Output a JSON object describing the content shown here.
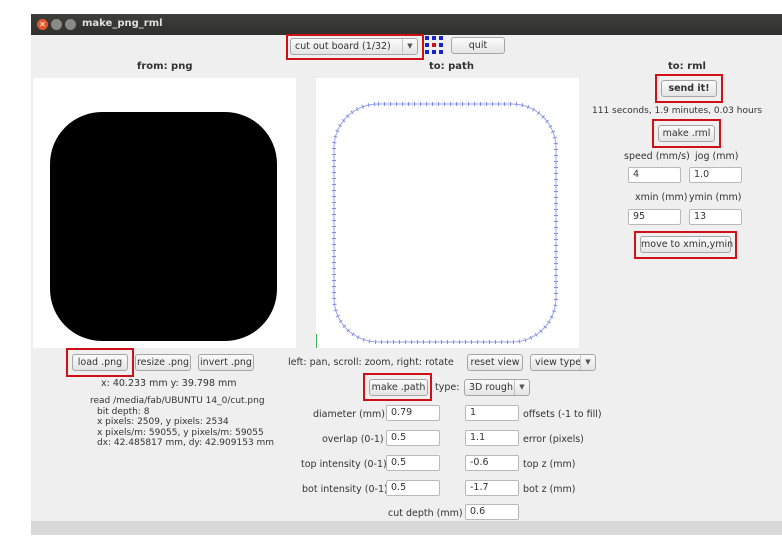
{
  "window": {
    "title": "make_png_rml"
  },
  "toolbar": {
    "mode": "cut out board (1/32)",
    "quit": "quit"
  },
  "left": {
    "header": "from: png",
    "load": "load .png",
    "resize": "resize .png",
    "invert": "invert .png",
    "coords": "x: 40.233 mm  y: 39.798 mm",
    "info": [
      "read /media/fab/UBUNTU 14_0/cut.png",
      "  bit depth: 8",
      "  x pixels: 2509, y pixels: 2534",
      "  x pixels/m: 59055, y pixels/m: 59055",
      "  dx: 42.485817 mm, dy: 42.909153 mm"
    ]
  },
  "middle": {
    "header": "to: path",
    "hint": "left: pan, scroll: zoom, right: rotate",
    "reset_view": "reset view",
    "view_type": "view type",
    "make_path": "make .path",
    "type_label": "type:",
    "type_value": "3D rough",
    "diameter_label": "diameter (mm)",
    "diameter": "0.79",
    "offsets": "1",
    "offsets_label": "offsets (-1 to fill)",
    "overlap_label": "overlap (0-1)",
    "overlap": "0.5",
    "error": "1.1",
    "error_label": "error (pixels)",
    "top_intensity_label": "top intensity (0-1)",
    "top_intensity": "0.5",
    "top_z": "-0.6",
    "top_z_label": "top z (mm)",
    "bot_intensity_label": "bot intensity (0-1)",
    "bot_intensity": "0.5",
    "bot_z": "-1.7",
    "bot_z_label": "bot z (mm)",
    "cut_depth_label": "cut depth (mm)",
    "cut_depth": "0.6"
  },
  "right": {
    "header": "to: rml",
    "send": "send it!",
    "estimate": "111 seconds, 1.9 minutes, 0.03 hours",
    "make_rml": "make .rml",
    "speed_label": "speed (mm/s)",
    "jog_label": "jog (mm)",
    "speed": "4",
    "jog": "1.0",
    "xmin_label": "xmin (mm)",
    "ymin_label": "ymin (mm)",
    "xmin": "95",
    "ymin": "13",
    "move": "move to xmin,ymin"
  },
  "colors": {
    "highlight": "#cf1016",
    "toolpath": "#7d8de8",
    "tool_icon_blue": "#1a22c9",
    "tool_icon_red": "#cf1016"
  }
}
